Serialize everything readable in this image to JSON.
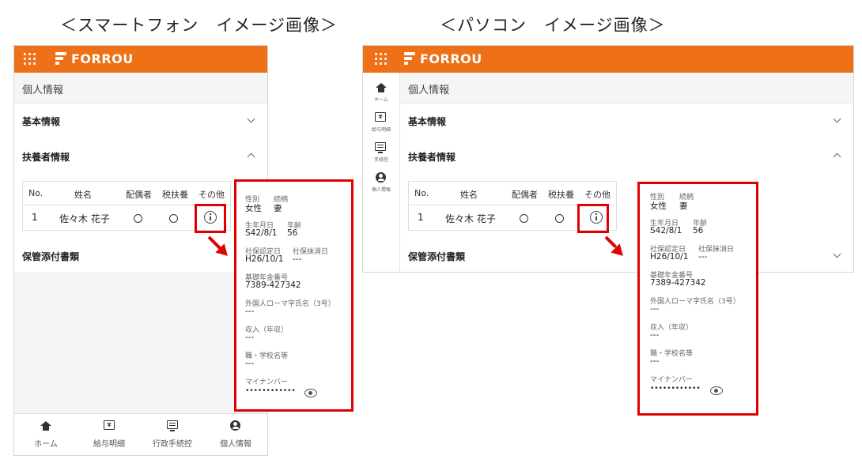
{
  "captions": {
    "smartphone": "＜スマートフォン　イメージ画像＞",
    "pc": "＜パソコン　イメージ画像＞"
  },
  "app": {
    "brand": "FORROU",
    "accent_color": "#ee7117",
    "page_title": "個人情報",
    "sections": {
      "basic": "基本情報",
      "dependents": "扶養者情報",
      "attachments": "保管添付書類"
    },
    "table": {
      "headers": [
        "No.",
        "姓名",
        "配偶者",
        "税扶養",
        "その他"
      ],
      "rows": [
        {
          "no": "1",
          "name": "佐々木 花子",
          "spouse_mark": "〇",
          "tax_mark": "〇",
          "other_icon": "info-icon"
        }
      ]
    }
  },
  "popup": {
    "gender_label": "性別",
    "relation_label": "続柄",
    "gender": "女性",
    "relation": "妻",
    "birth_label": "生年月日",
    "age_label": "年齢",
    "birth": "S42/8/1",
    "age": "56",
    "ins_start_label": "社保認定日",
    "ins_end_label": "社保抹消日",
    "ins_start": "H26/10/1",
    "ins_end": "---",
    "pension_label": "基礎年金番号",
    "pension": "7389-427342",
    "roman_label": "外国人ローマ字氏名（3号）",
    "roman": "---",
    "income_label": "収入（年収）",
    "income": "---",
    "job_label": "職・学校名等",
    "job": "---",
    "mynumber_label": "マイナンバー",
    "mynumber": "••••••••••••",
    "eye_icon": "eye-icon"
  },
  "bottom_nav": [
    {
      "label": "ホーム",
      "icon": "home-icon"
    },
    {
      "label": "給与明細",
      "icon": "yen-icon"
    },
    {
      "label": "行政手続控",
      "icon": "document-icon"
    },
    {
      "label": "個人情報",
      "icon": "person-icon"
    }
  ],
  "side_nav": [
    {
      "label": "ホーム",
      "icon": "home-icon"
    },
    {
      "label": "給与明細",
      "icon": "yen-icon"
    },
    {
      "label": "手続控",
      "icon": "document-icon"
    },
    {
      "label": "個人情報",
      "icon": "person-icon"
    }
  ]
}
